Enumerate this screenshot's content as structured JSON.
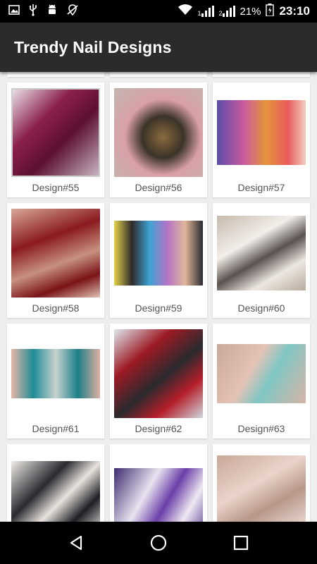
{
  "status_bar": {
    "sim1": "1",
    "sim2": "2",
    "battery": "21%",
    "time": "23:10"
  },
  "app": {
    "title": "Trendy Nail Designs"
  },
  "designs": [
    {
      "label": "Design#55"
    },
    {
      "label": "Design#56"
    },
    {
      "label": "Design#57"
    },
    {
      "label": "Design#58"
    },
    {
      "label": "Design#59"
    },
    {
      "label": "Design#60"
    },
    {
      "label": "Design#61"
    },
    {
      "label": "Design#62"
    },
    {
      "label": "Design#63"
    }
  ],
  "icons": {
    "status": [
      "image-icon",
      "usb-icon",
      "android-debug-icon",
      "no-location-icon",
      "wifi-icon",
      "signal-icon",
      "battery-icon"
    ],
    "nav": [
      "back-icon",
      "home-icon",
      "recents-icon"
    ]
  }
}
